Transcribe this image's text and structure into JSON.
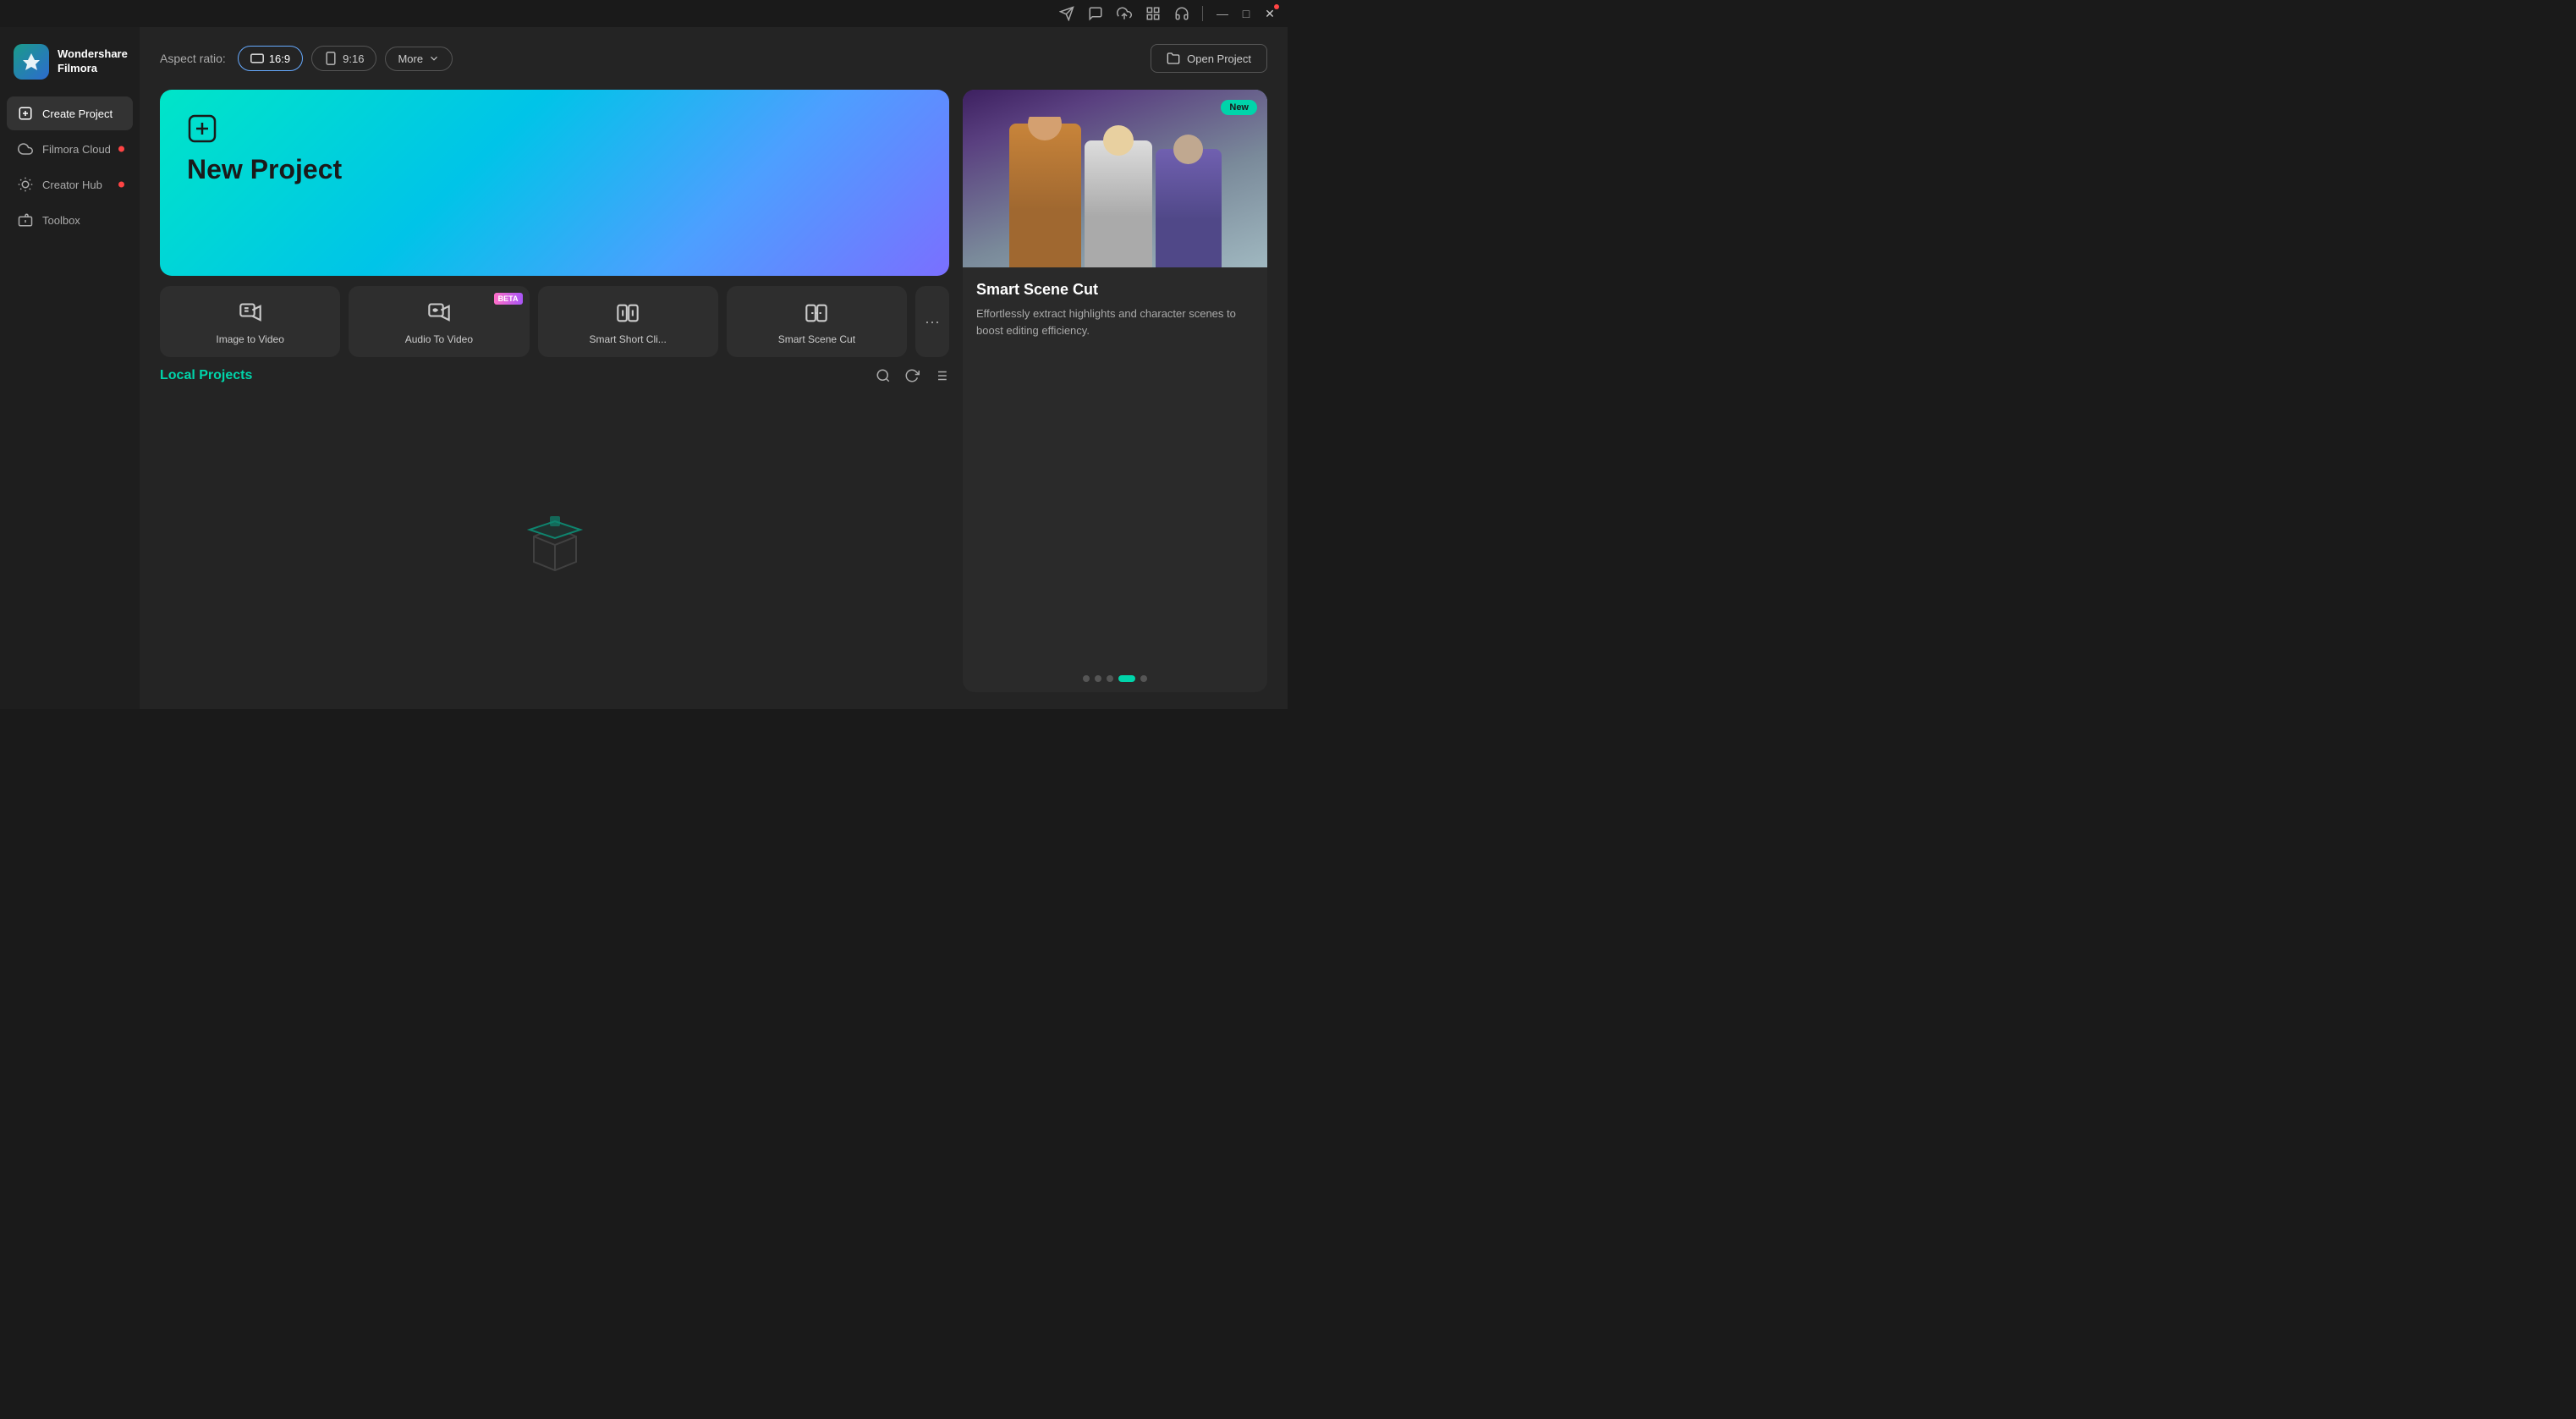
{
  "titlebar": {
    "icons": [
      "send-icon",
      "chat-icon",
      "upload-icon",
      "grid-icon",
      "headset-icon"
    ],
    "win_min": "—",
    "win_max": "□",
    "win_close": "✕"
  },
  "sidebar": {
    "logo": {
      "name": "Wondershare\nFilmora"
    },
    "nav": [
      {
        "id": "create-project",
        "label": "Create Project",
        "icon": "plus-square-icon",
        "active": true,
        "dot": false
      },
      {
        "id": "filmora-cloud",
        "label": "Filmora Cloud",
        "icon": "cloud-icon",
        "active": false,
        "dot": true
      },
      {
        "id": "creator-hub",
        "label": "Creator Hub",
        "icon": "bulb-icon",
        "active": false,
        "dot": true
      },
      {
        "id": "toolbox",
        "label": "Toolbox",
        "icon": "toolbox-icon",
        "active": false,
        "dot": false
      }
    ]
  },
  "main": {
    "aspect_ratio_label": "Aspect ratio:",
    "aspect_16_9": "16:9",
    "aspect_9_16": "9:16",
    "more_label": "More",
    "open_project_label": "Open Project",
    "new_project_label": "New Project",
    "tools": [
      {
        "id": "image-to-video",
        "label": "Image to Video",
        "beta": false
      },
      {
        "id": "audio-to-video",
        "label": "Audio To Video",
        "beta": true
      },
      {
        "id": "smart-short-clip",
        "label": "Smart Short Cli...",
        "beta": false
      },
      {
        "id": "smart-scene-cut",
        "label": "Smart Scene Cut",
        "beta": false
      }
    ],
    "local_projects_title": "Local Projects",
    "feature_card": {
      "badge": "New",
      "title": "Smart Scene Cut",
      "description": "Effortlessly extract highlights and character scenes to boost editing efficiency.",
      "dots": 5,
      "active_dot": 3
    }
  }
}
